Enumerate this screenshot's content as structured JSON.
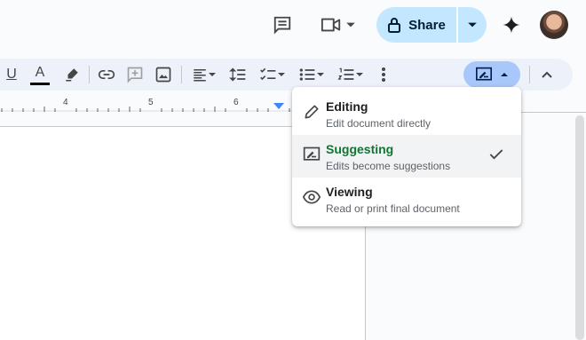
{
  "header": {
    "share_label": "Share"
  },
  "toolbar": {
    "underline_glyph": "U",
    "text_color_glyph": "A",
    "text_color_swatch": "#000000",
    "mode_button_color": "#a8c7fa"
  },
  "ruler": {
    "ticks": [
      "4",
      "5",
      "6"
    ]
  },
  "mode_menu": {
    "items": [
      {
        "title": "Editing",
        "subtitle": "Edit document directly",
        "icon": "pencil-icon",
        "selected": false
      },
      {
        "title": "Suggesting",
        "subtitle": "Edits become suggestions",
        "icon": "suggest-edits-icon",
        "selected": true
      },
      {
        "title": "Viewing",
        "subtitle": "Read or print final document",
        "icon": "eye-icon",
        "selected": false
      }
    ],
    "selected_color": "#137333"
  }
}
